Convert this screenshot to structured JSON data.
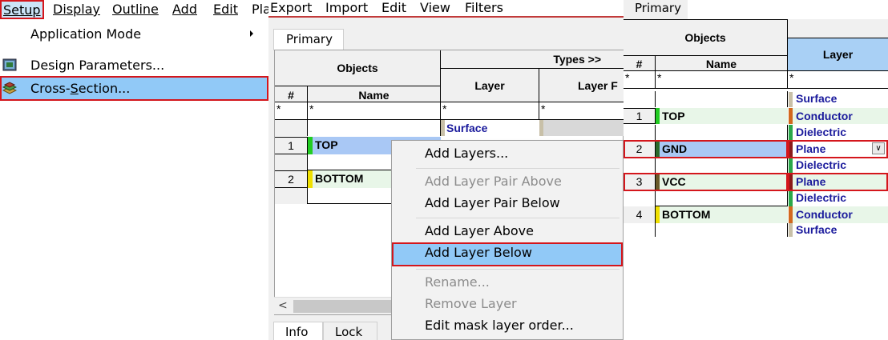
{
  "colors": {
    "menu_highlight": "#91c9f7",
    "annotation_red": "#d4161c",
    "surface": "#c8c0a8",
    "conductor": "#d2691e",
    "dielectric": "#2aa84a",
    "plane": "#8b1a1a",
    "top_marker": "#22cc22",
    "bottom_marker": "#f0e000",
    "gnd_marker": "#2a6a2a",
    "vcc_marker": "#6a5a2a",
    "layer_text": "#1a1a9c",
    "selected_row": "#a9c8f5"
  },
  "panel1": {
    "menubar": [
      {
        "label": "Setup",
        "underline_index": 0
      },
      {
        "label": "Display",
        "underline_index": 0
      },
      {
        "label": "Outline",
        "underline_index": 0
      },
      {
        "label": "Add",
        "underline_index": 0
      },
      {
        "label": "Edit",
        "underline_index": 0
      },
      {
        "label": "Pla",
        "underline_index": -1
      }
    ],
    "menu_items": [
      {
        "label": "Application Mode",
        "submenu": true,
        "icon": ""
      },
      {
        "label": "Design Parameters...",
        "submenu": false,
        "icon": "design-parameters-icon"
      },
      {
        "label": "Cross-Section...",
        "submenu": false,
        "icon": "cross-section-icon",
        "selected": true
      }
    ]
  },
  "panel2": {
    "menubar": [
      "Export",
      "Import",
      "Edit",
      "View",
      "Filters"
    ],
    "tab_top": "Primary",
    "grid": {
      "header_objects": "Objects",
      "header_types": "Types >>",
      "col_num": "#",
      "col_name": "Name",
      "col_layer": "Layer",
      "col_layer_f": "Layer F",
      "filter": "*",
      "surface": "Surface",
      "rows": [
        {
          "num": "1",
          "name": "TOP"
        },
        {
          "num": "2",
          "name": "BOTTOM"
        }
      ]
    },
    "tabs_bottom": [
      "Info",
      "Lock"
    ],
    "context_menu": [
      {
        "label": "Add Layers...",
        "disabled": false
      },
      {
        "label": "Add Layer Pair Above",
        "disabled": true
      },
      {
        "label": "Add Layer Pair Below",
        "disabled": false
      },
      {
        "label": "Add Layer Above",
        "disabled": false
      },
      {
        "label": "Add Layer Below",
        "disabled": false,
        "highlighted": true
      },
      {
        "label": "Rename...",
        "disabled": true
      },
      {
        "label": "Remove Layer",
        "disabled": true
      },
      {
        "label": "Edit mask layer order...",
        "disabled": false
      }
    ]
  },
  "panel3": {
    "tab": "Primary",
    "header_objects": "Objects",
    "col_num": "#",
    "col_name": "Name",
    "col_layer": "Layer",
    "filter": "*",
    "rows": [
      {
        "num": "",
        "name": "",
        "layer": "Surface"
      },
      {
        "num": "1",
        "name": "TOP",
        "layer": "Conductor"
      },
      {
        "num": "",
        "name": "",
        "layer": "Dielectric"
      },
      {
        "num": "2",
        "name": "GND",
        "layer": "Plane",
        "selected": true
      },
      {
        "num": "",
        "name": "",
        "layer": "Dielectric"
      },
      {
        "num": "3",
        "name": "VCC",
        "layer": "Plane"
      },
      {
        "num": "",
        "name": "",
        "layer": "Dielectric"
      },
      {
        "num": "4",
        "name": "BOTTOM",
        "layer": "Conductor"
      },
      {
        "num": "",
        "name": "",
        "layer": "Surface"
      }
    ]
  }
}
